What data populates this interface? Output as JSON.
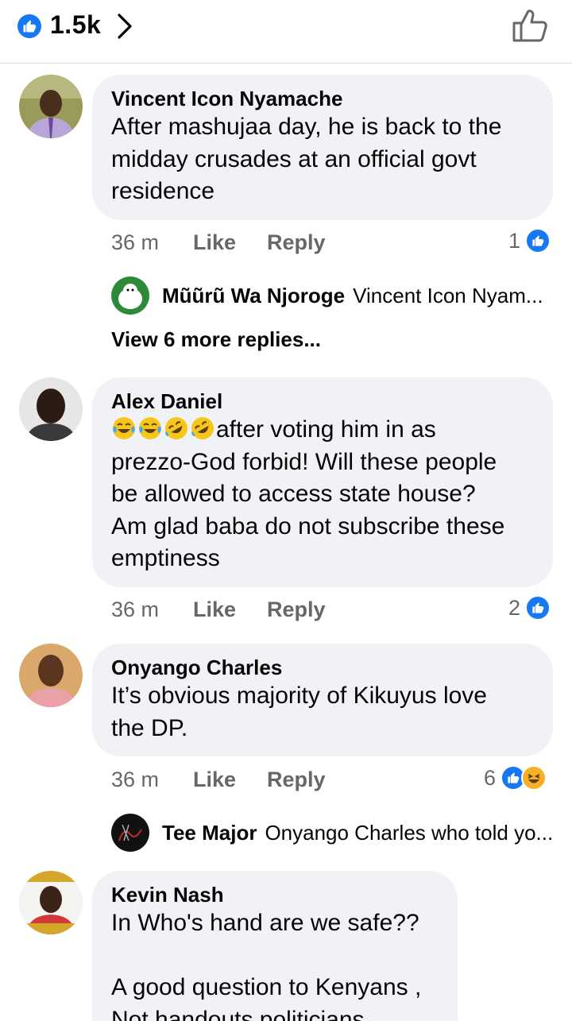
{
  "header": {
    "reaction_count": "1.5k",
    "reaction_icon": "like-icon",
    "chevron_icon": "chevron-right-icon",
    "like_button_icon": "thumbs-up-outline-icon"
  },
  "comments": [
    {
      "author": "Vincent Icon Nyamache",
      "text_lines": [
        "After mashujaa day, he is back to the",
        "midday crusades at an official govt",
        "residence"
      ],
      "time": "36 m",
      "like_label": "Like",
      "reply_label": "Reply",
      "reaction_count": "1",
      "reply_preview": {
        "author": "Mũũrũ Wa Njoroge",
        "text": "Vincent Icon Nyam..."
      },
      "view_more": "View 6 more replies..."
    },
    {
      "author": "Alex Daniel",
      "emojis": [
        "😂",
        "😂",
        "🤣",
        "🤣"
      ],
      "text_lines": [
        "after voting him in as",
        "prezzo-God forbid! Will these people",
        "be allowed to access state house?",
        "Am glad baba do not subscribe these",
        "emptiness"
      ],
      "time": "36 m",
      "like_label": "Like",
      "reply_label": "Reply",
      "reaction_count": "2"
    },
    {
      "author": "Onyango Charles",
      "text_lines": [
        "It’s obvious majority of Kikuyus love",
        "the DP."
      ],
      "time": "36 m",
      "like_label": "Like",
      "reply_label": "Reply",
      "reaction_count": "6",
      "reply_preview": {
        "author": "Tee Major",
        "text": "Onyango Charles who told yo..."
      }
    },
    {
      "author": "Kevin Nash",
      "text_lines": [
        "In Who's hand are we safe??",
        "",
        "A good question to Kenyans ,",
        "Not handouts politicians"
      ]
    }
  ],
  "colors": {
    "facebook_blue": "#1877f2",
    "bubble_bg": "#f0f2f5",
    "meta_gray": "#65676b",
    "haha_yellow": "#f7b125"
  }
}
